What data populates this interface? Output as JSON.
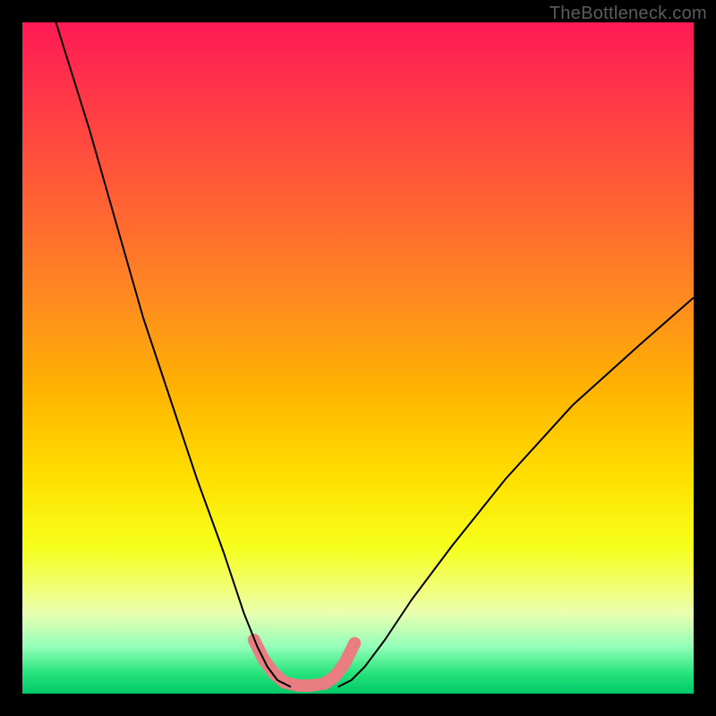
{
  "watermark": "TheBottleneck.com",
  "chart_data": {
    "type": "line",
    "title": "",
    "xlabel": "",
    "ylabel": "",
    "xlim": [
      0,
      100
    ],
    "ylim": [
      0,
      100
    ],
    "grid": false,
    "legend": false,
    "series": [
      {
        "name": "left-curve",
        "stroke": "#000000",
        "stroke_width": 2,
        "x": [
          5,
          10,
          14,
          18,
          22,
          26,
          30,
          33,
          35,
          36.5,
          38,
          40
        ],
        "y": [
          100,
          84,
          70,
          56,
          44,
          32,
          21,
          12,
          7,
          4,
          2,
          1
        ]
      },
      {
        "name": "right-curve",
        "stroke": "#000000",
        "stroke_width": 2,
        "x": [
          47,
          49,
          51,
          54,
          58,
          64,
          72,
          82,
          92,
          100
        ],
        "y": [
          1,
          2,
          4,
          8,
          14,
          22,
          32,
          43,
          52,
          59
        ]
      },
      {
        "name": "trough-highlight",
        "stroke": "#e97e82",
        "stroke_width": 14,
        "linecap": "round",
        "x": [
          34.5,
          36,
          37.5,
          39,
          41,
          43,
          45,
          46.5,
          48,
          49.5
        ],
        "y": [
          8,
          5,
          3,
          1.7,
          1.2,
          1.2,
          1.5,
          2.5,
          4.5,
          7.5
        ]
      }
    ],
    "background_gradient": {
      "direction": "vertical",
      "stops": [
        {
          "pos": 0.0,
          "color": "#ff1a55"
        },
        {
          "pos": 0.3,
          "color": "#ff6a2f"
        },
        {
          "pos": 0.55,
          "color": "#ffb400"
        },
        {
          "pos": 0.78,
          "color": "#f6ff1a"
        },
        {
          "pos": 0.93,
          "color": "#93ffb9"
        },
        {
          "pos": 1.0,
          "color": "#00c86a"
        }
      ]
    }
  }
}
